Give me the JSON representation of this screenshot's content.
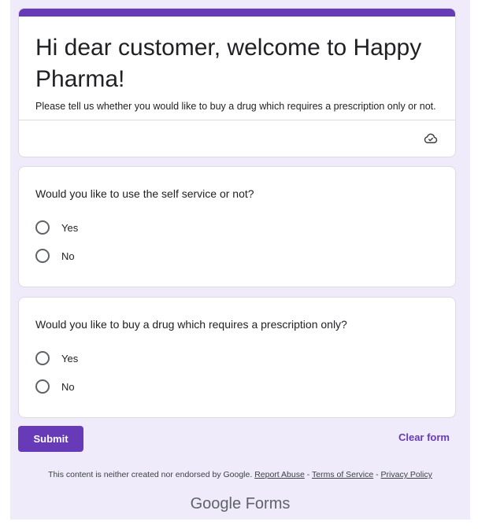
{
  "form": {
    "title": "Hi dear customer, welcome to Happy Pharma!",
    "description": "Please tell us whether you would like to buy a drug which requires a prescription only or not.",
    "accent_color": "#673ab7",
    "background_color": "#efebfb",
    "cloud_icon": "cloud-check-icon"
  },
  "questions": [
    {
      "text": "Would you like to use the self service or not?",
      "options": [
        "Yes",
        "No"
      ]
    },
    {
      "text": "Would you like to buy a drug which requires a prescription only?",
      "options": [
        "Yes",
        "No"
      ]
    }
  ],
  "actions": {
    "submit_label": "Submit",
    "clear_label": "Clear form"
  },
  "footer": {
    "disclaimer": "This content is neither created nor endorsed by Google.",
    "report_abuse": "Report Abuse",
    "sep1": " - ",
    "terms": "Terms of Service",
    "sep2": " - ",
    "privacy": "Privacy Policy"
  },
  "brand": {
    "google": "Google",
    "forms": "Forms"
  }
}
